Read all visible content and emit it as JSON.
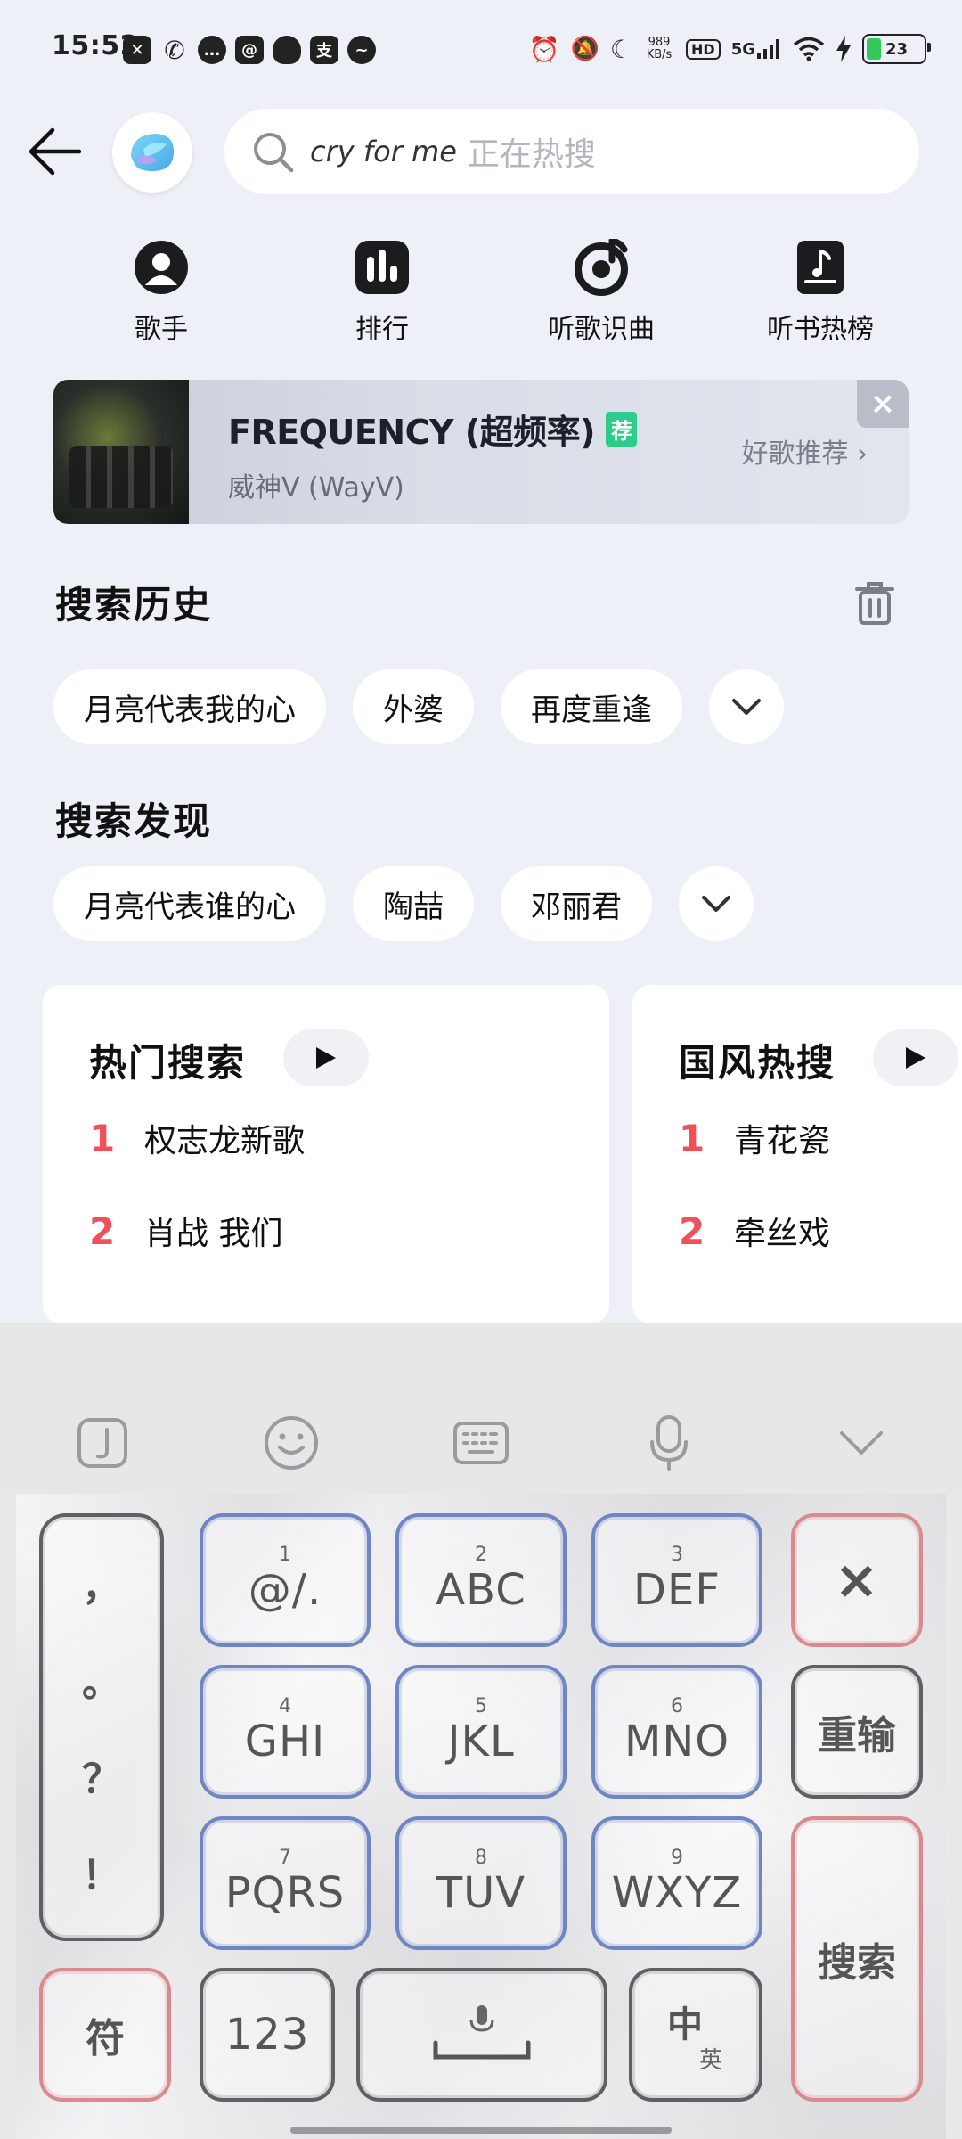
{
  "status_bar": {
    "time": "15:52",
    "net_speed_value": "989",
    "net_speed_unit": "KB/s",
    "hd_label": "HD",
    "network_label": "5G",
    "battery": "23",
    "app_icons": [
      "capcut-icon",
      "missed-call-icon",
      "message-icon",
      "email-icon",
      "qq-icon",
      "alipay-icon",
      "weibo-icon"
    ]
  },
  "header": {
    "search_query": "cry for me",
    "search_hint": "正在热搜"
  },
  "quick_nav": [
    {
      "label": "歌手",
      "icon": "singer-icon"
    },
    {
      "label": "排行",
      "icon": "chart-icon"
    },
    {
      "label": "听歌识曲",
      "icon": "music-recognition-icon"
    },
    {
      "label": "听书热榜",
      "icon": "book-icon"
    }
  ],
  "banner": {
    "title": "FREQUENCY (超频率)",
    "tag": "荐",
    "artist": "威神V (WayV)",
    "link": "好歌推荐 ›",
    "close": "×"
  },
  "history": {
    "title": "搜索历史",
    "chips": [
      "月亮代表我的心",
      "外婆",
      "再度重逢"
    ]
  },
  "discover": {
    "title": "搜索发现",
    "chips": [
      "月亮代表谁的心",
      "陶喆",
      "邓丽君"
    ]
  },
  "hot_cards": [
    {
      "title": "热门搜索",
      "items": [
        {
          "rank": "1",
          "text": "权志龙新歌"
        },
        {
          "rank": "2",
          "text": "肖战 我们"
        }
      ]
    },
    {
      "title": "国风热搜",
      "items": [
        {
          "rank": "1",
          "text": "青花瓷"
        },
        {
          "rank": "2",
          "text": "牵丝戏"
        }
      ]
    }
  ],
  "keyboard": {
    "punctuation": [
      "，",
      "。",
      "？",
      "！"
    ],
    "keys": [
      {
        "num": "1",
        "label": "@/."
      },
      {
        "num": "2",
        "label": "ABC"
      },
      {
        "num": "3",
        "label": "DEF"
      },
      {
        "num": "4",
        "label": "GHI"
      },
      {
        "num": "5",
        "label": "JKL"
      },
      {
        "num": "6",
        "label": "MNO"
      },
      {
        "num": "7",
        "label": "PQRS"
      },
      {
        "num": "8",
        "label": "TUV"
      },
      {
        "num": "9",
        "label": "WXYZ"
      }
    ],
    "delete": "×",
    "reset": "重输",
    "search": "搜索",
    "symbols": "符",
    "numbers": "123",
    "lang_main": "中",
    "lang_sub": "英"
  },
  "colors": {
    "background": "#eef0f7",
    "rank_red": "#f0505a",
    "tag_green": "#2ecc8a",
    "key_blue": "#6f85c4",
    "key_red": "#d98a8e"
  }
}
